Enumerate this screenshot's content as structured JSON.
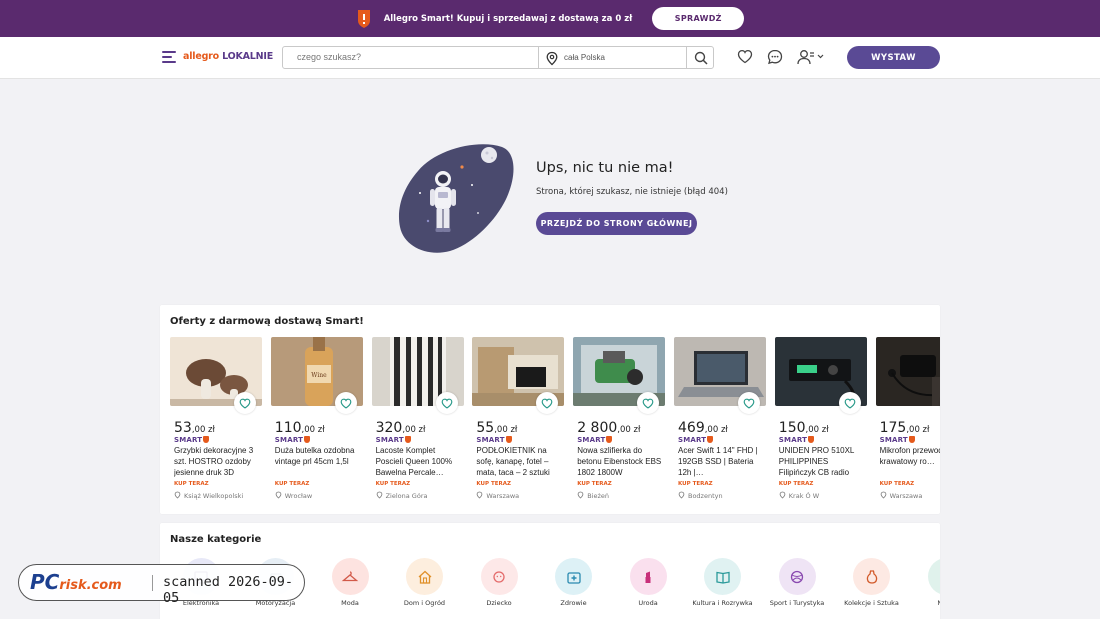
{
  "promo": {
    "text": "Allegro Smart! Kupuj i sprzedawaj z dostawą za 0 zł",
    "button": "SPRAWDŹ"
  },
  "header": {
    "logo_main": "allegro",
    "logo_sub": "LOKALNIE",
    "search_placeholder": "czego szukasz?",
    "location_placeholder": "cała Polska",
    "sell_button": "WYSTAW"
  },
  "error": {
    "title": "Ups, nic tu nie ma!",
    "subtitle": "Strona, której szukasz, nie istnieje (błąd 404)",
    "home_button": "PRZEJDŹ DO STRONY GŁÓWNEJ"
  },
  "offers": {
    "title": "Oferty z darmową dostawą Smart!",
    "smart_label": "SMART",
    "buy_now_label": "KUP TERAZ",
    "items": [
      {
        "price_main": "53",
        "price_cents": ",00 zł",
        "title": "Grzybki dekoracyjne 3 szt. HOSTRO ozdoby jesienne druk 3D",
        "city": "Książ Wielkopolski"
      },
      {
        "price_main": "110",
        "price_cents": ",00 zł",
        "title": "Duża butelka ozdobna vintage prl 45cm 1,5l",
        "city": "Wrocław"
      },
      {
        "price_main": "320",
        "price_cents": ",00 zł",
        "title": "Lacoste Komplet Poscieli Queen 100% Bawelna Percale…",
        "city": "Zielona Góra"
      },
      {
        "price_main": "55",
        "price_cents": ",00 zł",
        "title": "PODŁOKIETNIK na sofę, kanapę, fotel – mata, taca – 2 sztuki",
        "city": "Warszawa"
      },
      {
        "price_main": "2 800",
        "price_cents": ",00 zł",
        "title": "Nowa szlifierka do betonu Eibenstock EBS 1802 1800W",
        "city": "Bieżeń"
      },
      {
        "price_main": "469",
        "price_cents": ",00 zł",
        "title": "Acer Swift 1 14\" FHD | 192GB SSD | Bateria 12h |…",
        "city": "Bodzentyn"
      },
      {
        "price_main": "150",
        "price_cents": ",00 zł",
        "title": "UNIDEN PRO 510XL PHILIPPINES Filipińczyk CB radio",
        "city": "Krak Ó W"
      },
      {
        "price_main": "175",
        "price_cents": ",00 zł",
        "title": "Mikrofon przewodowy krawatowy ro…",
        "city": "Warszawa"
      }
    ]
  },
  "categories": {
    "title": "Nasze kategorie",
    "items": [
      {
        "label": "Elektronika",
        "icon": "electronics-icon",
        "color": "#e7e8f7"
      },
      {
        "label": "Motoryzacja",
        "icon": "car-icon",
        "color": "#e6eef5"
      },
      {
        "label": "Moda",
        "icon": "hanger-icon",
        "color": "#fde3e0"
      },
      {
        "label": "Dom i Ogród",
        "icon": "house-icon",
        "color": "#fdeede"
      },
      {
        "label": "Dziecko",
        "icon": "baby-icon",
        "color": "#fde8e8"
      },
      {
        "label": "Zdrowie",
        "icon": "first-aid-icon",
        "color": "#ddf1f6"
      },
      {
        "label": "Uroda",
        "icon": "lipstick-icon",
        "color": "#fae0ee"
      },
      {
        "label": "Kultura i Rozrywka",
        "icon": "book-icon",
        "color": "#e0f2f2"
      },
      {
        "label": "Sport i Turystyka",
        "icon": "ball-icon",
        "color": "#efe4f5"
      },
      {
        "label": "Kolekcje i Sztuka",
        "icon": "vase-icon",
        "color": "#fde9e3"
      },
      {
        "label": "Nie…",
        "icon": "misc-icon",
        "color": "#e0f2ec"
      }
    ]
  },
  "watermark": {
    "logo": "PC",
    "logo_suffix": "risk.com",
    "text": "scanned 2026-09-05"
  },
  "colors": {
    "brand_purple": "#5a2a6e",
    "button_purple": "#5a4a95",
    "accent_orange": "#e55a1c"
  }
}
